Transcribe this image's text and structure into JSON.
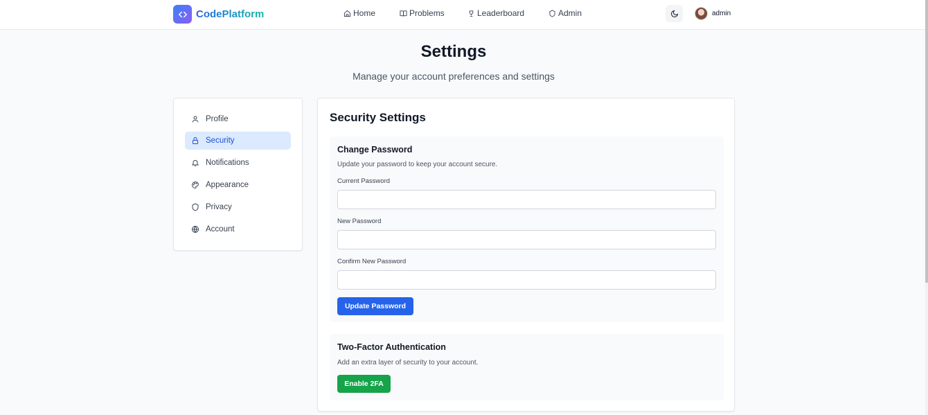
{
  "header": {
    "brand": "CodePlatform",
    "nav": [
      {
        "label": "Home",
        "icon": "home-icon"
      },
      {
        "label": "Problems",
        "icon": "book-icon"
      },
      {
        "label": "Leaderboard",
        "icon": "trophy-icon"
      },
      {
        "label": "Admin",
        "icon": "shield-icon"
      }
    ],
    "theme_toggle_icon": "moon-icon",
    "user_name": "admin"
  },
  "page": {
    "title": "Settings",
    "subtitle": "Manage your account preferences and settings"
  },
  "sidebar": {
    "items": [
      {
        "label": "Profile",
        "icon": "user-icon",
        "active": false
      },
      {
        "label": "Security",
        "icon": "lock-icon",
        "active": true
      },
      {
        "label": "Notifications",
        "icon": "bell-icon",
        "active": false
      },
      {
        "label": "Appearance",
        "icon": "palette-icon",
        "active": false
      },
      {
        "label": "Privacy",
        "icon": "shield-icon",
        "active": false
      },
      {
        "label": "Account",
        "icon": "globe-icon",
        "active": false
      }
    ]
  },
  "main": {
    "title": "Security Settings",
    "password": {
      "title": "Change Password",
      "description": "Update your password to keep your account secure.",
      "current_label": "Current Password",
      "current_value": "",
      "new_label": "New Password",
      "new_value": "",
      "confirm_label": "Confirm New Password",
      "confirm_value": "",
      "button": "Update Password"
    },
    "two_factor": {
      "title": "Two-Factor Authentication",
      "description": "Add an extra layer of security to your account.",
      "button": "Enable 2FA"
    }
  },
  "colors": {
    "accent": "#2563eb",
    "active_bg": "#dbeafe",
    "success": "#16a34a"
  }
}
